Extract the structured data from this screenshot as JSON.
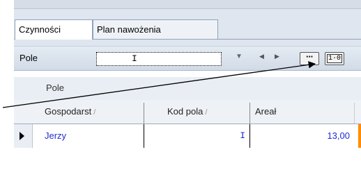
{
  "tabs": [
    {
      "label": "Czynności",
      "active": true
    },
    {
      "label": "Plan nawożenia",
      "active": false
    }
  ],
  "toolbar": {
    "field_label": "Pole",
    "combo_value": "I",
    "combo_arrow": "▼",
    "nav_prev": "◀",
    "nav_next": "▶",
    "ellipsis_label": "···",
    "io_label": "1·0"
  },
  "grid": {
    "group_label": "Pole",
    "columns": [
      {
        "label": "Gospodarst",
        "sort": "/"
      },
      {
        "label": "Kod pola",
        "sort": "/"
      },
      {
        "label": "Areał",
        "sort": ""
      }
    ],
    "rows": [
      {
        "gospodarstwo": "Jerzy",
        "kod_pola": "I",
        "areal": "13,00"
      }
    ]
  },
  "colors": {
    "link_text": "#1a2bd6",
    "accent_fragment": "#ff8c00"
  }
}
